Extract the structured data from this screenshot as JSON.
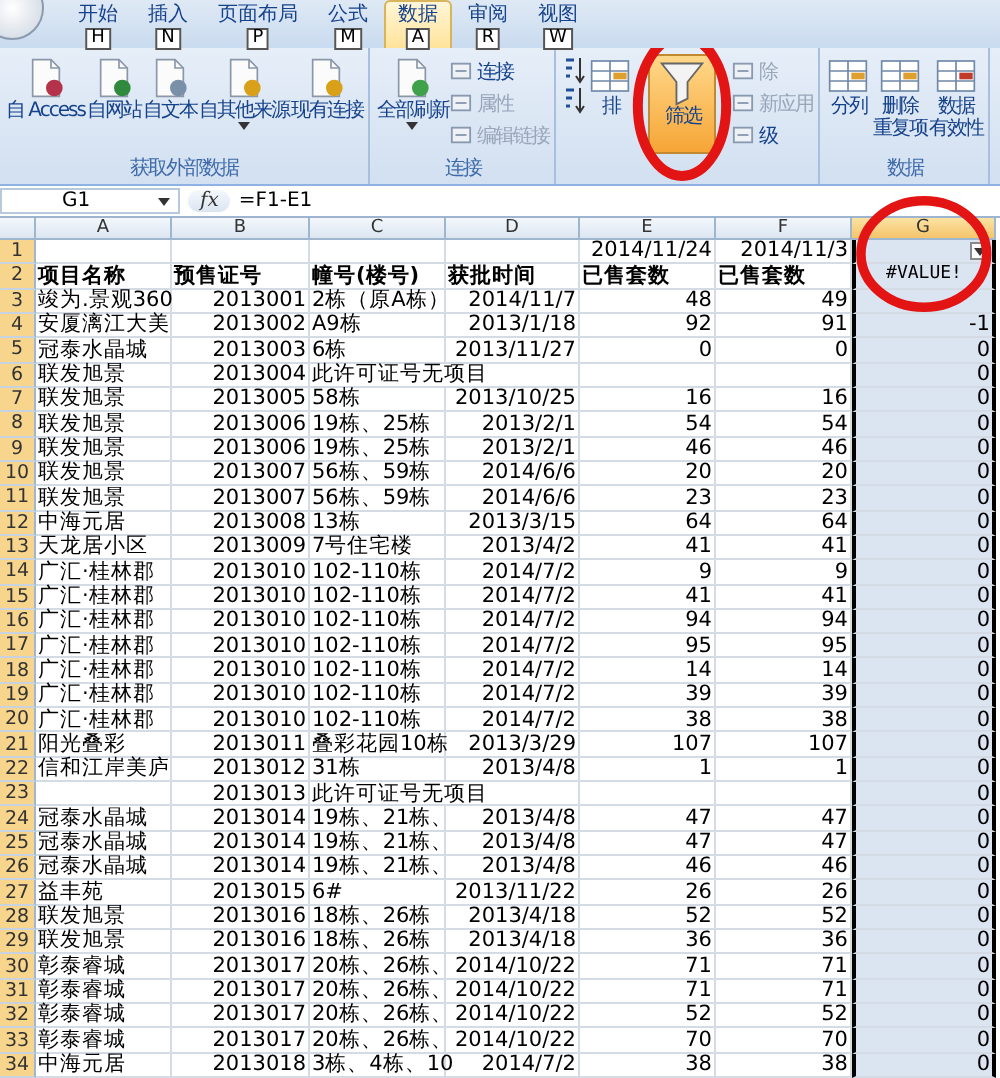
{
  "ribbon": {
    "tabs": [
      {
        "label": "开始",
        "key": "H",
        "selected": false
      },
      {
        "label": "插入",
        "key": "N",
        "selected": false
      },
      {
        "label": "页面布局",
        "key": "P",
        "selected": false
      },
      {
        "label": "公式",
        "key": "M",
        "selected": false
      },
      {
        "label": "数据",
        "key": "A",
        "selected": true
      },
      {
        "label": "审阅",
        "key": "R",
        "selected": false
      },
      {
        "label": "视图",
        "key": "W",
        "selected": false
      }
    ],
    "groups": [
      {
        "label": "获取外部数据",
        "buttons": [
          {
            "label": "自 Access",
            "kind": "large",
            "dropdown": false,
            "disabled": false,
            "active": false
          },
          {
            "label": "自网站",
            "kind": "large",
            "dropdown": false,
            "disabled": false,
            "active": false
          },
          {
            "label": "自文本",
            "kind": "large",
            "dropdown": false,
            "disabled": false,
            "active": false
          },
          {
            "label": "自其他来源",
            "kind": "large",
            "dropdown": true,
            "disabled": false,
            "active": false
          },
          {
            "label": "现有连接",
            "kind": "large",
            "dropdown": false,
            "disabled": false,
            "active": false
          }
        ]
      },
      {
        "label": "连接",
        "buttons": [
          {
            "label": "全部刷新",
            "kind": "large",
            "dropdown": true,
            "disabled": false,
            "active": false
          },
          {
            "kind": "stack",
            "items": [
              {
                "label": "连接",
                "disabled": false
              },
              {
                "label": "属性",
                "disabled": true
              },
              {
                "label": "编辑链接",
                "disabled": true
              }
            ]
          }
        ]
      },
      {
        "buttons": [
          {
            "kind": "sort_pair"
          },
          {
            "label": "排",
            "kind": "large",
            "dropdown": false,
            "disabled": false,
            "active": false
          },
          {
            "label": "筛选",
            "kind": "large",
            "dropdown": false,
            "disabled": false,
            "active": true
          },
          {
            "kind": "stack",
            "items": [
              {
                "label": "除",
                "disabled": true
              },
              {
                "label": "新应用",
                "disabled": true
              },
              {
                "label": "级",
                "disabled": false
              }
            ]
          }
        ]
      },
      {
        "label": "数据",
        "buttons": [
          {
            "label": "分列",
            "kind": "large",
            "dropdown": false,
            "disabled": false,
            "active": false
          },
          {
            "lines": [
              "删除",
              "重复项"
            ],
            "kind": "large",
            "dropdown": false,
            "disabled": false,
            "active": false
          },
          {
            "lines": [
              "数据",
              "有效性"
            ],
            "kind": "large",
            "dropdown": false,
            "disabled": false,
            "active": false
          }
        ]
      }
    ]
  },
  "formula_bar": {
    "name_box": "G1",
    "function_symbol": "fx",
    "formula": "=F1-E1"
  },
  "sheet": {
    "columns": [
      {
        "label": "A",
        "selected": false,
        "filter": false
      },
      {
        "label": "B",
        "selected": false,
        "filter": false
      },
      {
        "label": "C",
        "selected": false,
        "filter": false
      },
      {
        "label": "D",
        "selected": false,
        "filter": false
      },
      {
        "label": "E",
        "selected": false,
        "filter": false
      },
      {
        "label": "F",
        "selected": false,
        "filter": false
      },
      {
        "label": "G",
        "selected": true,
        "filter": true
      }
    ],
    "rows": [
      {
        "number": "1",
        "kind": "data",
        "cells": [
          "",
          "",
          "",
          "",
          "2014/11/24",
          "2014/11/3",
          ""
        ]
      },
      {
        "number": "2",
        "kind": "header",
        "cells": [
          "项目名称",
          "预售证号",
          "幢号(楼号)",
          "获批时间",
          "已售套数",
          "已售套数",
          "#VALUE!"
        ]
      },
      {
        "number": "3",
        "kind": "data",
        "cells": [
          "竣为.景观360",
          "2013001",
          "2栋（原A栋）",
          "2014/11/7",
          "48",
          "49",
          ""
        ]
      },
      {
        "number": "4",
        "kind": "data",
        "cells": [
          "安厦漓江大美",
          "2013002",
          "A9栋",
          "2013/1/18",
          "92",
          "91",
          "-1"
        ]
      },
      {
        "number": "5",
        "kind": "data",
        "cells": [
          "冠泰水晶城",
          "2013003",
          "6栋",
          "2013/11/27",
          "0",
          "0",
          "0"
        ]
      },
      {
        "number": "6",
        "kind": "data",
        "cells": [
          "联发旭景",
          "2013004",
          "此许可证号无项目",
          "",
          "",
          "",
          "0"
        ]
      },
      {
        "number": "7",
        "kind": "data",
        "cells": [
          "联发旭景",
          "2013005",
          "58栋",
          "2013/10/25",
          "16",
          "16",
          "0"
        ]
      },
      {
        "number": "8",
        "kind": "data",
        "cells": [
          "联发旭景",
          "2013006",
          "19栋、25栋",
          "2013/2/1",
          "54",
          "54",
          "0"
        ]
      },
      {
        "number": "9",
        "kind": "data",
        "cells": [
          "联发旭景",
          "2013006",
          "19栋、25栋",
          "2013/2/1",
          "46",
          "46",
          "0"
        ]
      },
      {
        "number": "10",
        "kind": "data",
        "cells": [
          "联发旭景",
          "2013007",
          "56栋、59栋",
          "2014/6/6",
          "20",
          "20",
          "0"
        ]
      },
      {
        "number": "11",
        "kind": "data",
        "cells": [
          "联发旭景",
          "2013007",
          "56栋、59栋",
          "2014/6/6",
          "23",
          "23",
          "0"
        ]
      },
      {
        "number": "12",
        "kind": "data",
        "cells": [
          "中海元居",
          "2013008",
          "13栋",
          "2013/3/15",
          "64",
          "64",
          "0"
        ]
      },
      {
        "number": "13",
        "kind": "data",
        "cells": [
          "天龙居小区",
          "2013009",
          "7号住宅楼",
          "2013/4/2",
          "41",
          "41",
          "0"
        ]
      },
      {
        "number": "14",
        "kind": "data",
        "cells": [
          "广汇·桂林郡",
          "2013010",
          "102-110栋",
          "2014/7/2",
          "9",
          "9",
          "0"
        ]
      },
      {
        "number": "15",
        "kind": "data",
        "cells": [
          "广汇·桂林郡",
          "2013010",
          "102-110栋",
          "2014/7/2",
          "41",
          "41",
          "0"
        ]
      },
      {
        "number": "16",
        "kind": "data",
        "cells": [
          "广汇·桂林郡",
          "2013010",
          "102-110栋",
          "2014/7/2",
          "94",
          "94",
          "0"
        ]
      },
      {
        "number": "17",
        "kind": "data",
        "cells": [
          "广汇·桂林郡",
          "2013010",
          "102-110栋",
          "2014/7/2",
          "95",
          "95",
          "0"
        ]
      },
      {
        "number": "18",
        "kind": "data",
        "cells": [
          "广汇·桂林郡",
          "2013010",
          "102-110栋",
          "2014/7/2",
          "14",
          "14",
          "0"
        ]
      },
      {
        "number": "19",
        "kind": "data",
        "cells": [
          "广汇·桂林郡",
          "2013010",
          "102-110栋",
          "2014/7/2",
          "39",
          "39",
          "0"
        ]
      },
      {
        "number": "20",
        "kind": "data",
        "cells": [
          "广汇·桂林郡",
          "2013010",
          "102-110栋",
          "2014/7/2",
          "38",
          "38",
          "0"
        ]
      },
      {
        "number": "21",
        "kind": "data",
        "cells": [
          "阳光叠彩",
          "2013011",
          "叠彩花园10栋",
          "2013/3/29",
          "107",
          "107",
          "0"
        ]
      },
      {
        "number": "22",
        "kind": "data",
        "cells": [
          "信和江岸美庐",
          "2013012",
          "31栋",
          "2013/4/8",
          "1",
          "1",
          "0"
        ]
      },
      {
        "number": "23",
        "kind": "data",
        "cells": [
          "",
          "2013013",
          "此许可证号无项目",
          "",
          "",
          "",
          "0"
        ]
      },
      {
        "number": "24",
        "kind": "data",
        "cells": [
          "冠泰水晶城",
          "2013014",
          "19栋、21栋、",
          "2013/4/8",
          "47",
          "47",
          "0"
        ]
      },
      {
        "number": "25",
        "kind": "data",
        "cells": [
          "冠泰水晶城",
          "2013014",
          "19栋、21栋、",
          "2013/4/8",
          "47",
          "47",
          "0"
        ]
      },
      {
        "number": "26",
        "kind": "data",
        "cells": [
          "冠泰水晶城",
          "2013014",
          "19栋、21栋、",
          "2013/4/8",
          "46",
          "46",
          "0"
        ]
      },
      {
        "number": "27",
        "kind": "data",
        "cells": [
          "益丰苑",
          "2013015",
          "6#",
          "2013/11/22",
          "26",
          "26",
          "0"
        ]
      },
      {
        "number": "28",
        "kind": "data",
        "cells": [
          "联发旭景",
          "2013016",
          "18栋、26栋",
          "2013/4/18",
          "52",
          "52",
          "0"
        ]
      },
      {
        "number": "29",
        "kind": "data",
        "cells": [
          "联发旭景",
          "2013016",
          "18栋、26栋",
          "2013/4/18",
          "36",
          "36",
          "0"
        ]
      },
      {
        "number": "30",
        "kind": "data",
        "cells": [
          "彰泰睿城",
          "2013017",
          "20栋、26栋、",
          "2014/10/22",
          "71",
          "71",
          "0"
        ]
      },
      {
        "number": "31",
        "kind": "data",
        "cells": [
          "彰泰睿城",
          "2013017",
          "20栋、26栋、",
          "2014/10/22",
          "71",
          "71",
          "0"
        ]
      },
      {
        "number": "32",
        "kind": "data",
        "cells": [
          "彰泰睿城",
          "2013017",
          "20栋、26栋、",
          "2014/10/22",
          "52",
          "52",
          "0"
        ]
      },
      {
        "number": "33",
        "kind": "data",
        "cells": [
          "彰泰睿城",
          "2013017",
          "20栋、26栋、",
          "2014/10/22",
          "70",
          "70",
          "0"
        ]
      },
      {
        "number": "34",
        "kind": "data",
        "cells": [
          "中海元居",
          "2013018",
          "3栋、4栋、10",
          "2014/7/2",
          "38",
          "38",
          "0"
        ]
      }
    ]
  }
}
